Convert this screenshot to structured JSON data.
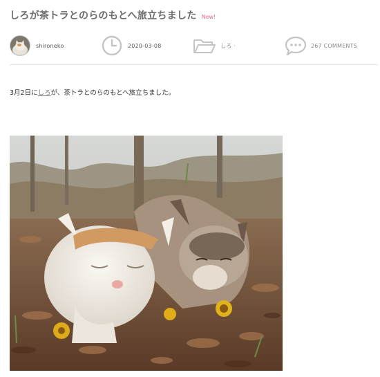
{
  "post": {
    "title": "しろが茶トラとのらのもとへ旅立ちました",
    "new_badge": "New!"
  },
  "meta": {
    "author": "shironeko",
    "date": "2020-03-08",
    "category": "しろ ·",
    "comments": "267 COMMENTS"
  },
  "icons": {
    "avatar": "cat-avatar",
    "date": "clock-icon",
    "category": "folder-icon",
    "comments": "speech-bubble-icon"
  },
  "content": {
    "before_link": "3月2日に",
    "link_text": "しろ",
    "after_link": "が、茶トラとのらのもとへ旅立ちました。"
  },
  "colors": {
    "new_badge": "#f06a8a",
    "icon_gray": "#c4c4c4",
    "title": "#6b6b6b"
  }
}
